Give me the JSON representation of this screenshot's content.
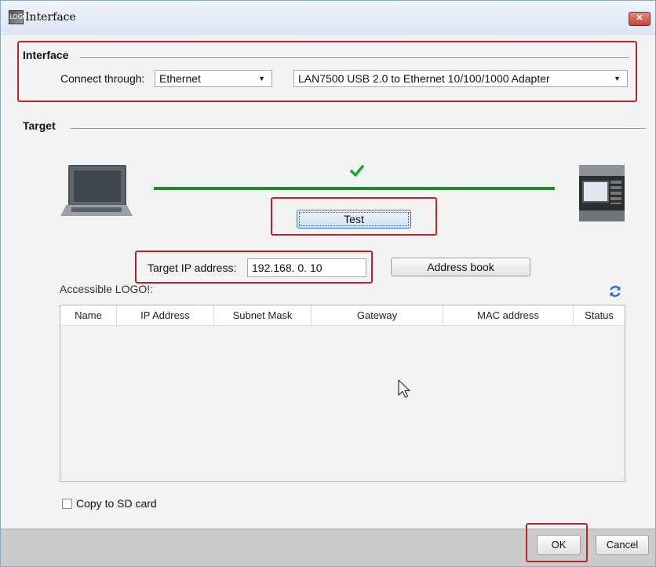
{
  "window": {
    "title": "Interface",
    "app_icon_text": "LOGO"
  },
  "interface_section": {
    "title": "Interface",
    "connect_label": "Connect through:",
    "connect_value": "Ethernet",
    "adapter_value": "LAN7500 USB 2.0 to Ethernet 10/100/1000 Adapter"
  },
  "target_section": {
    "title": "Target",
    "test_button": "Test",
    "ip_label": "Target IP address:",
    "ip_value": "192.168. 0. 10",
    "address_book_button": "Address book"
  },
  "accessible": {
    "label": "Accessible LOGO!:",
    "columns": [
      "Name",
      "IP Address",
      "Subnet Mask",
      "Gateway",
      "MAC address",
      "Status"
    ]
  },
  "copy_sd_label": "Copy to SD card",
  "footer": {
    "ok_button": "OK",
    "cancel_button": "Cancel"
  },
  "colors": {
    "highlight": "#b3262b",
    "connection": "#1e8a2a",
    "refresh": "#2a6fd6"
  }
}
